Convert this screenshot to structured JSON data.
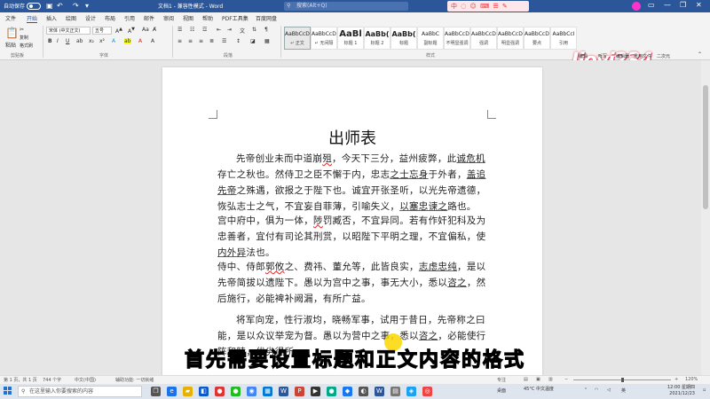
{
  "titlebar": {
    "autosave_label": "自动保存",
    "doc_title": "文档1 - 兼容性模式 - Word",
    "search_placeholder": "搜索(Alt+Q)",
    "ime_label": "中 ◌ ☺ ⌨ ☰ ✎",
    "user_label": "孫"
  },
  "tabs": [
    "文件",
    "开始",
    "插入",
    "绘图",
    "设计",
    "布局",
    "引用",
    "邮件",
    "审阅",
    "视图",
    "帮助",
    "PDF工具集",
    "百度网盘"
  ],
  "ribbon": {
    "clipboard": {
      "paste": "粘贴",
      "cut": "✂",
      "copy": "复制",
      "format_painter": "格式刷",
      "label": "剪贴板"
    },
    "font": {
      "name": "宋体 (中文正文)",
      "size": "五号",
      "label": "字体",
      "bold": "B",
      "italic": "I",
      "underline": "U"
    },
    "paragraph": {
      "label": "段落"
    },
    "styles": {
      "label": "样式",
      "items": [
        {
          "preview": "AaBbCcDd",
          "name": "↵ 正文"
        },
        {
          "preview": "AaBbCcDd",
          "name": "↵ 无间隔"
        },
        {
          "preview": "AaBl",
          "name": "标题 1"
        },
        {
          "preview": "AaBb(",
          "name": "标题 2"
        },
        {
          "preview": "AaBb(",
          "name": "标题"
        },
        {
          "preview": "AaBbC",
          "name": "副标题"
        },
        {
          "preview": "AaBbCcDd",
          "name": "不明显强调"
        },
        {
          "preview": "AaBbCcDd",
          "name": "强调"
        },
        {
          "preview": "AaBbCcDd",
          "name": "明显强调"
        },
        {
          "preview": "AaBbCcDd",
          "name": "要点"
        },
        {
          "preview": "AaBbCcI",
          "name": "引用"
        }
      ]
    },
    "editing": {
      "label": "编辑"
    },
    "logo_text": "Jiovi234",
    "right_labels": [
      "编辑",
      "听写",
      "编辑器",
      "重用文件",
      "二次元"
    ]
  },
  "document": {
    "title": "出师表",
    "p1_a": "先帝创业未而中道崩",
    "p1_b": "殂",
    "p1_c": "，今天下三分，益州疲弊，此",
    "p1_d": "诚危机",
    "p1_e": "存亡之秋也。然侍卫之臣不懈于内，忠志",
    "p1_f": "之士忘身",
    "p1_g": "于外者，",
    "p1_h": "盖追先帝",
    "p1_i": "之殊遇，欲报之于陛下也。诚宜开张圣听，以光先帝遗德，恢弘志士之气，不宜妄自菲薄，引喻失义，",
    "p1_j": "以塞忠谏之",
    "p1_k": "路也。",
    "p2_a": "宫中府中，俱为一体，",
    "p2_b": "陟",
    "p2_c": "罚臧否，不宜异同。若有作奸犯科及为忠善者，宜付有司论其刑赏，以昭陛下平明之理，不宜偏私，使",
    "p2_d": "内外",
    "p2_e": "异",
    "p2_f": "法也。",
    "p3_a": "侍中、侍郎",
    "p3_b": "郭攸",
    "p3_c": "之、费祎、董允等，此皆良实，",
    "p3_d": "志虑忠纯",
    "p3_e": "，是以先帝简拔以遗陛下。愚以为宫中之事，事无大小，悉以",
    "p3_f": "咨之",
    "p3_g": "，然后施行，必能裨补阙漏，有所广益。",
    "p4_a": "将军向宠，性行淑均，晓畅军事，试用于昔日，先帝称之曰能，是以众议举宠为督。愚以为营中之事，悉以",
    "p4_b": "咨之",
    "p4_c": "，必能使行阵和睦，优劣得所。"
  },
  "subtitle": "首先需要设置标题和正文内容的格式",
  "statusbar": {
    "page": "第 1 页，共 1 页",
    "words": "744 个字",
    "lang": "中文(中国)",
    "accessibility": "辅助功能: 一切就绪",
    "focus": "专注",
    "zoom": "120%"
  },
  "taskbar": {
    "search_placeholder": "在这里输入你要搜索的内容",
    "weather": "45°C 中文温度",
    "desktop": "桌面",
    "ime": "英",
    "time": "12:00 星期四",
    "date": "2021/12/23"
  }
}
